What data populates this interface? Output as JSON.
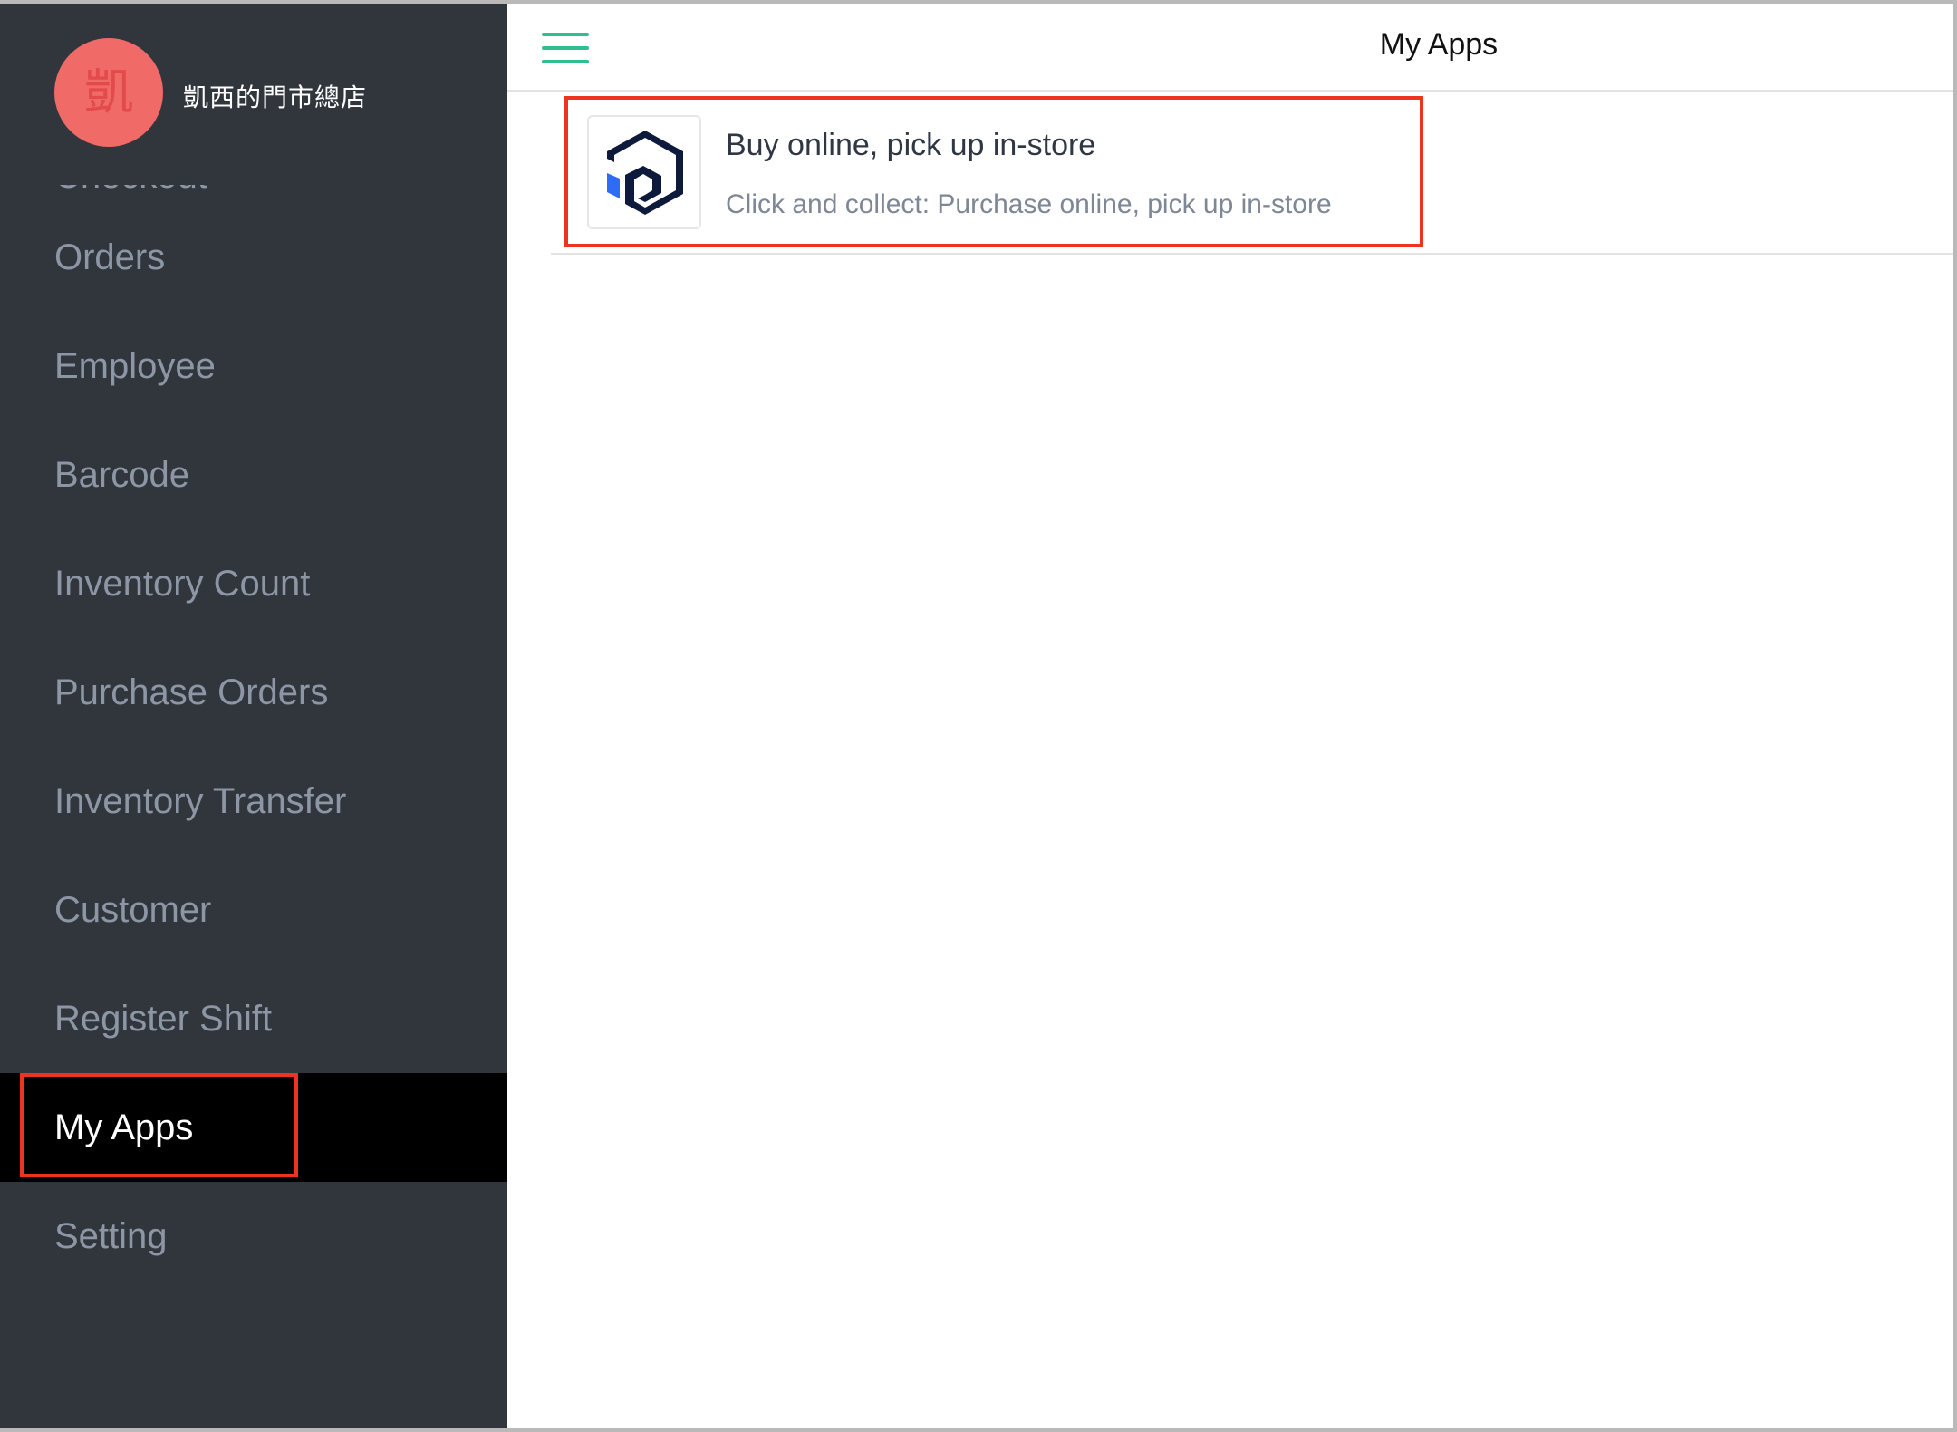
{
  "store": {
    "avatar_initial": "凱",
    "name": "凱西的門市總店"
  },
  "sidebar": {
    "items": [
      {
        "label": "Checkout"
      },
      {
        "label": "Orders"
      },
      {
        "label": "Employee"
      },
      {
        "label": "Barcode"
      },
      {
        "label": "Inventory Count"
      },
      {
        "label": "Purchase Orders"
      },
      {
        "label": "Inventory Transfer"
      },
      {
        "label": "Customer"
      },
      {
        "label": "Register Shift"
      },
      {
        "label": "My Apps"
      },
      {
        "label": "Setting"
      }
    ],
    "active_item": "My Apps"
  },
  "header": {
    "title": "My Apps",
    "menu_icon": "hamburger-menu-icon"
  },
  "apps": [
    {
      "name": "Buy online, pick up in-store",
      "description": "Click and collect: Purchase online, pick up in-store",
      "icon": "boxed-cube-logo-icon"
    }
  ],
  "colors": {
    "sidebar_bg": "#31363d",
    "sidebar_text": "#8d96a5",
    "active_bg": "#000000",
    "avatar": "#f06a67",
    "accent": "#2dbf8e",
    "highlight": "#ec3421",
    "logo_dark": "#0e1a3c",
    "logo_blue": "#2f6cf6"
  }
}
